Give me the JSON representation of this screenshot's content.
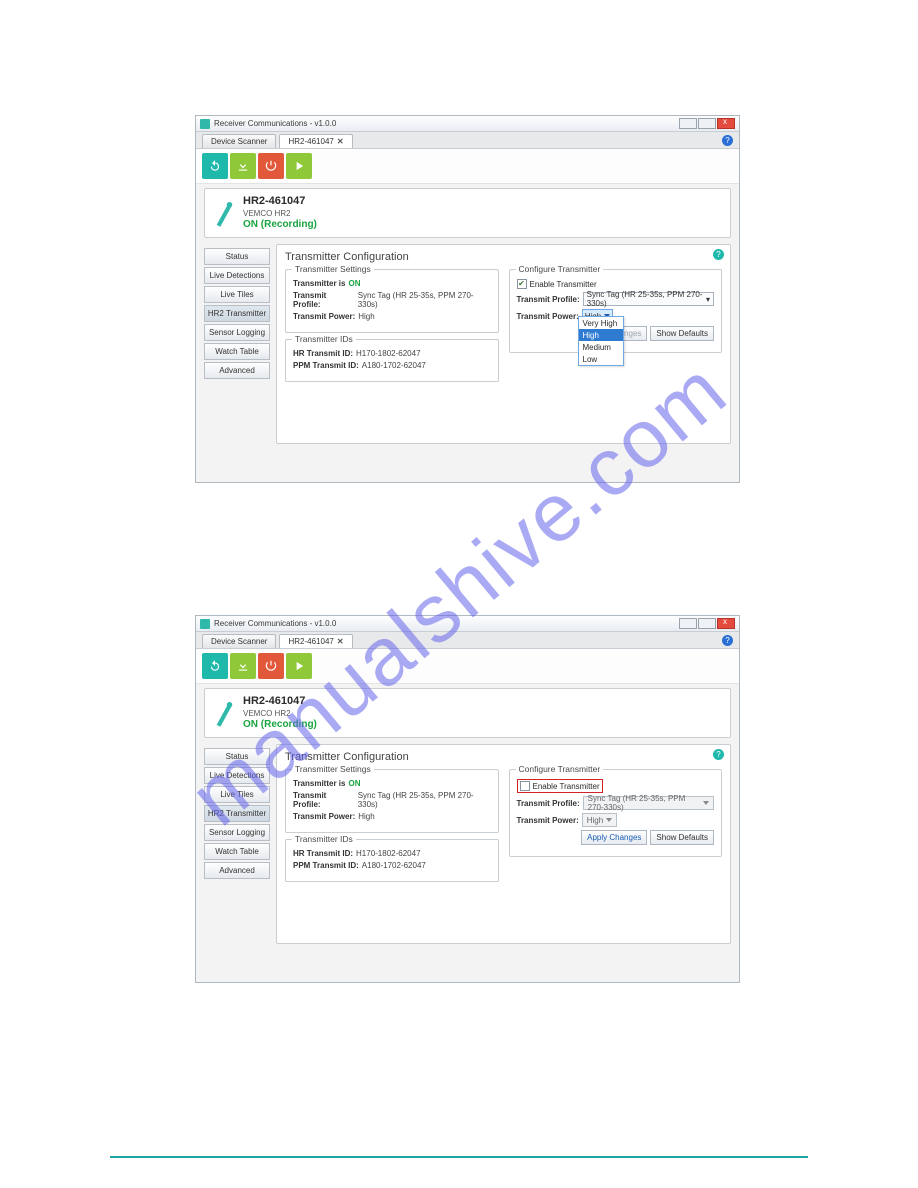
{
  "watermark": "manualshive.com",
  "window": {
    "title": "Receiver Communications - v1.0.0",
    "tabs": {
      "scanner": "Device Scanner",
      "active": "HR2-461047"
    }
  },
  "device": {
    "title": "HR2-461047",
    "subtitle": "VEMCO HR2",
    "status": "ON (Recording)"
  },
  "sidemenu": {
    "status": "Status",
    "live_detections": "Live Detections",
    "live_tiles": "Live Tiles",
    "hr2_transmitter": "HR2 Transmitter",
    "sensor_logging": "Sensor Logging",
    "watch_table": "Watch Table",
    "advanced": "Advanced"
  },
  "card": {
    "title": "Transmitter Configuration",
    "settings_legend": "Transmitter Settings",
    "ids_legend": "Transmitter IDs",
    "configure_legend": "Configure Transmitter",
    "transmitter_is_label": "Transmitter is",
    "transmitter_is_value": "ON",
    "profile_label": "Transmit Profile:",
    "profile_value": "Sync Tag (HR 25-35s, PPM 270-330s)",
    "power_label": "Transmit Power:",
    "power_value": "High",
    "hr_id_label": "HR Transmit ID:",
    "hr_id_value": "H170-1802-62047",
    "ppm_id_label": "PPM Transmit ID:",
    "ppm_id_value": "A180-1702-62047",
    "enable_label": "Enable Transmitter",
    "dd_options": {
      "very_high": "Very High",
      "high": "High",
      "medium": "Medium",
      "low": "Low"
    },
    "apply_btn": "Apply Changes",
    "defaults_btn": "Show Defaults"
  }
}
